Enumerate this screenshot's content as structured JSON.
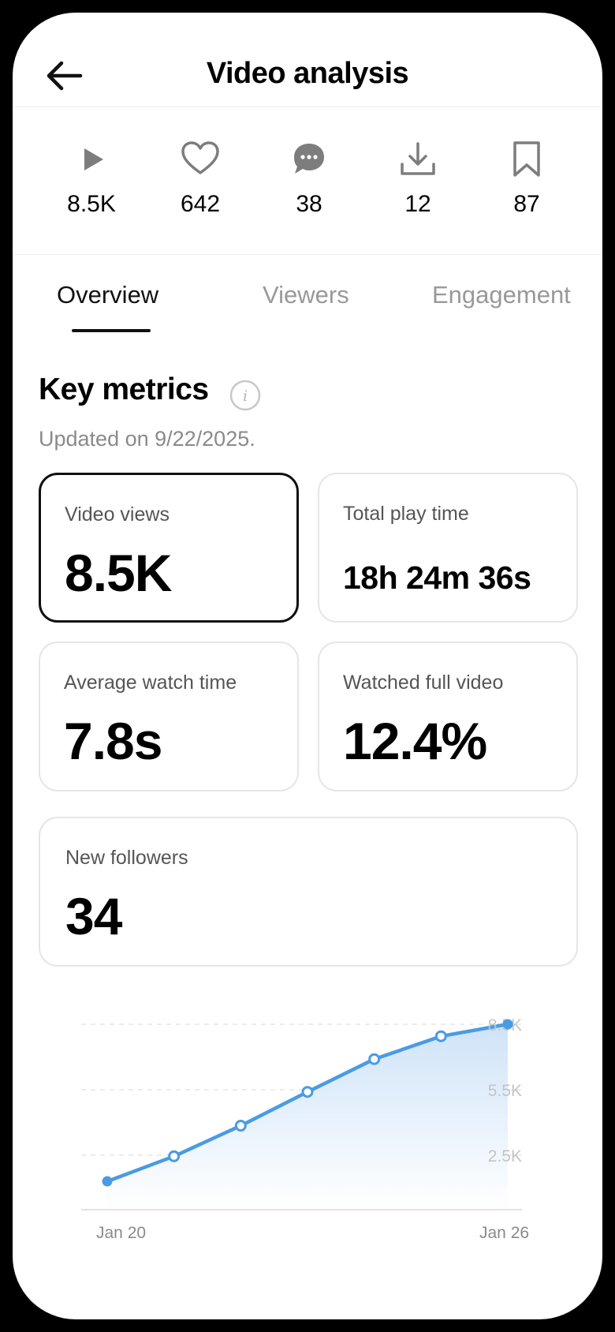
{
  "header": {
    "title": "Video analysis"
  },
  "stats": [
    {
      "icon": "play-icon",
      "value": "8.5K"
    },
    {
      "icon": "heart-icon",
      "value": "642"
    },
    {
      "icon": "comment-icon",
      "value": "38"
    },
    {
      "icon": "download-icon",
      "value": "12"
    },
    {
      "icon": "bookmark-icon",
      "value": "87"
    }
  ],
  "tabs": [
    {
      "label": "Overview",
      "active": true
    },
    {
      "label": "Viewers",
      "active": false
    },
    {
      "label": "Engagement",
      "active": false
    }
  ],
  "metrics": {
    "title": "Key metrics",
    "updated": "Updated on 9/22/2025.",
    "cards": [
      {
        "label": "Video views",
        "value": "8.5K",
        "selected": true
      },
      {
        "label": "Total play time",
        "value": "18h 24m 36s",
        "selected": false
      },
      {
        "label": "Average watch time",
        "value": "7.8s",
        "selected": false
      },
      {
        "label": "Watched full video",
        "value": "12.4%",
        "selected": false
      },
      {
        "label": "New followers",
        "value": "34",
        "selected": false
      }
    ]
  },
  "colors": {
    "accent": "#4a9be4",
    "area_top": "#cfe3f8"
  },
  "chart_data": {
    "type": "area",
    "title": "",
    "xlabel": "",
    "ylabel": "",
    "ylim": [
      0,
      8500
    ],
    "y_ticks": [
      "8.5K",
      "5.5K",
      "2.5K"
    ],
    "y_tick_values": [
      8500,
      5500,
      2500
    ],
    "x_labels": [
      "Jan 20",
      "Jan 26"
    ],
    "series": [
      {
        "values": [
          1300,
          2450,
          3850,
          5400,
          6900,
          7950,
          8500
        ]
      }
    ],
    "grid": true
  }
}
